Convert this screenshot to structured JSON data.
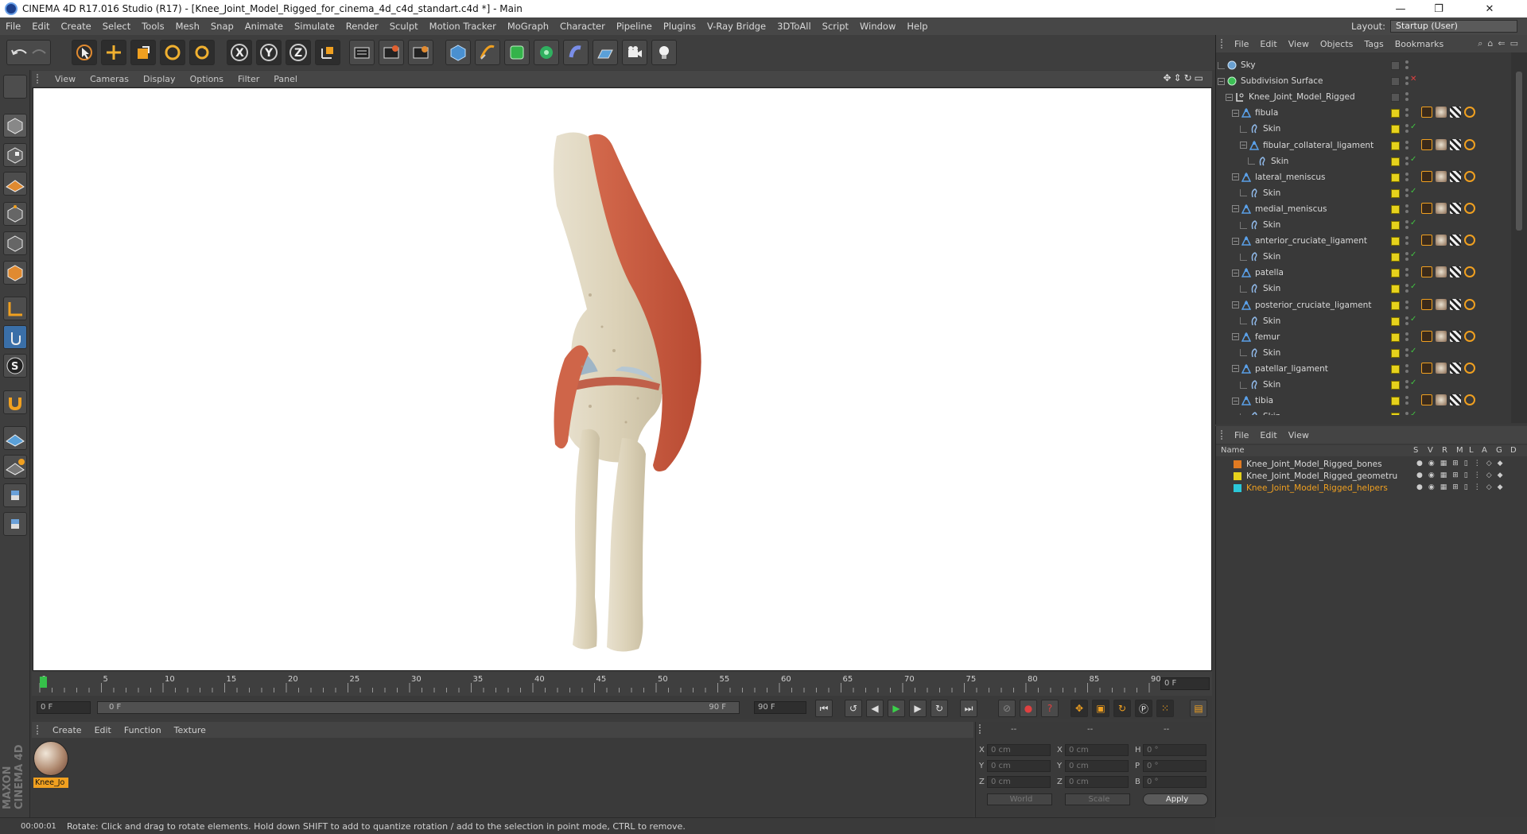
{
  "window": {
    "title": "CINEMA 4D R17.016 Studio (R17) - [Knee_Joint_Model_Rigged_for_cinema_4d_c4d_standart.c4d *] - Main",
    "controls": [
      "—",
      "❐",
      "✕"
    ]
  },
  "menu": [
    "File",
    "Edit",
    "Create",
    "Select",
    "Tools",
    "Mesh",
    "Snap",
    "Animate",
    "Simulate",
    "Render",
    "Sculpt",
    "Motion Tracker",
    "MoGraph",
    "Character",
    "Pipeline",
    "Plugins",
    "V-Ray Bridge",
    "3DToAll",
    "Script",
    "Window",
    "Help"
  ],
  "layout": {
    "label": "Layout:",
    "value": "Startup (User)"
  },
  "viewport": {
    "menu": [
      "View",
      "Cameras",
      "Display",
      "Options",
      "Filter",
      "Panel"
    ],
    "nav_icons": [
      "move-view-icon",
      "zoom-view-icon",
      "rotate-view-icon",
      "maximize-view-icon"
    ]
  },
  "timeline": {
    "ticks": [
      "0",
      "5",
      "10",
      "15",
      "20",
      "25",
      "30",
      "35",
      "40",
      "45",
      "50",
      "55",
      "60",
      "65",
      "70",
      "75",
      "80",
      "85",
      "90"
    ],
    "current_frame_field": "0 F",
    "start_field": "0 F",
    "range_start": "0 F",
    "range_end": "90 F",
    "end_field": "90 F"
  },
  "material_manager": {
    "menu": [
      "Create",
      "Edit",
      "Function",
      "Texture"
    ],
    "material_name": "Knee_Jo"
  },
  "coordinates": {
    "headers": [
      "--",
      "--",
      "--"
    ],
    "rows": [
      {
        "a": "X",
        "av": "0 cm",
        "b": "X",
        "bv": "0 cm",
        "c": "H",
        "cv": "0 °"
      },
      {
        "a": "Y",
        "av": "0 cm",
        "b": "Y",
        "bv": "0 cm",
        "c": "P",
        "cv": "0 °"
      },
      {
        "a": "Z",
        "av": "0 cm",
        "b": "Z",
        "bv": "0 cm",
        "c": "B",
        "cv": "0 °"
      }
    ],
    "world_select": "World",
    "scale_select": "Scale",
    "apply_label": "Apply"
  },
  "status": {
    "time": "00:00:01",
    "message": "Rotate: Click and drag to rotate elements. Hold down SHIFT to add to quantize rotation / add to the selection in point mode, CTRL to remove."
  },
  "object_manager": {
    "menu": [
      "File",
      "Edit",
      "View",
      "Objects",
      "Tags",
      "Bookmarks"
    ],
    "objects": [
      {
        "name": "Sky",
        "level": 0,
        "type": "sky"
      },
      {
        "name": "Subdivision Surface",
        "level": 0,
        "type": "subdiv"
      },
      {
        "name": "Knee_Joint_Model_Rigged",
        "level": 1,
        "type": "null"
      },
      {
        "name": "fibula",
        "level": 2,
        "type": "joint"
      },
      {
        "name": "Skin",
        "level": 3,
        "type": "skin"
      },
      {
        "name": "fibular_collateral_ligament",
        "level": 3,
        "type": "joint"
      },
      {
        "name": "Skin",
        "level": 4,
        "type": "skin"
      },
      {
        "name": "lateral_meniscus",
        "level": 2,
        "type": "joint"
      },
      {
        "name": "Skin",
        "level": 3,
        "type": "skin"
      },
      {
        "name": "medial_meniscus",
        "level": 2,
        "type": "joint"
      },
      {
        "name": "Skin",
        "level": 3,
        "type": "skin"
      },
      {
        "name": "anterior_cruciate_ligament",
        "level": 2,
        "type": "joint"
      },
      {
        "name": "Skin",
        "level": 3,
        "type": "skin"
      },
      {
        "name": "patella",
        "level": 2,
        "type": "joint"
      },
      {
        "name": "Skin",
        "level": 3,
        "type": "skin"
      },
      {
        "name": "posterior_cruciate_ligament",
        "level": 2,
        "type": "joint"
      },
      {
        "name": "Skin",
        "level": 3,
        "type": "skin"
      },
      {
        "name": "femur",
        "level": 2,
        "type": "joint"
      },
      {
        "name": "Skin",
        "level": 3,
        "type": "skin"
      },
      {
        "name": "patellar_ligament",
        "level": 2,
        "type": "joint"
      },
      {
        "name": "Skin",
        "level": 3,
        "type": "skin"
      },
      {
        "name": "tibia",
        "level": 2,
        "type": "joint"
      },
      {
        "name": "Skin",
        "level": 3,
        "type": "skin"
      }
    ]
  },
  "layer_manager": {
    "menu": [
      "File",
      "Edit",
      "View"
    ],
    "columns": [
      "Name",
      "S",
      "V",
      "R",
      "M",
      "L",
      "A",
      "G",
      "D"
    ],
    "layers": [
      {
        "name": "Knee_Joint_Model_Rigged_bones",
        "color": "#e07a22",
        "highlight": false
      },
      {
        "name": "Knee_Joint_Model_Rigged_geometru",
        "color": "#e6d21c",
        "highlight": false
      },
      {
        "name": "Knee_Joint_Model_Rigged_helpers",
        "color": "#2bc7d8",
        "highlight": true
      }
    ]
  },
  "colors": {
    "accent": "#f0a020",
    "viewport_bg": "#ffffff",
    "panel_bg": "#3a3a3a"
  }
}
